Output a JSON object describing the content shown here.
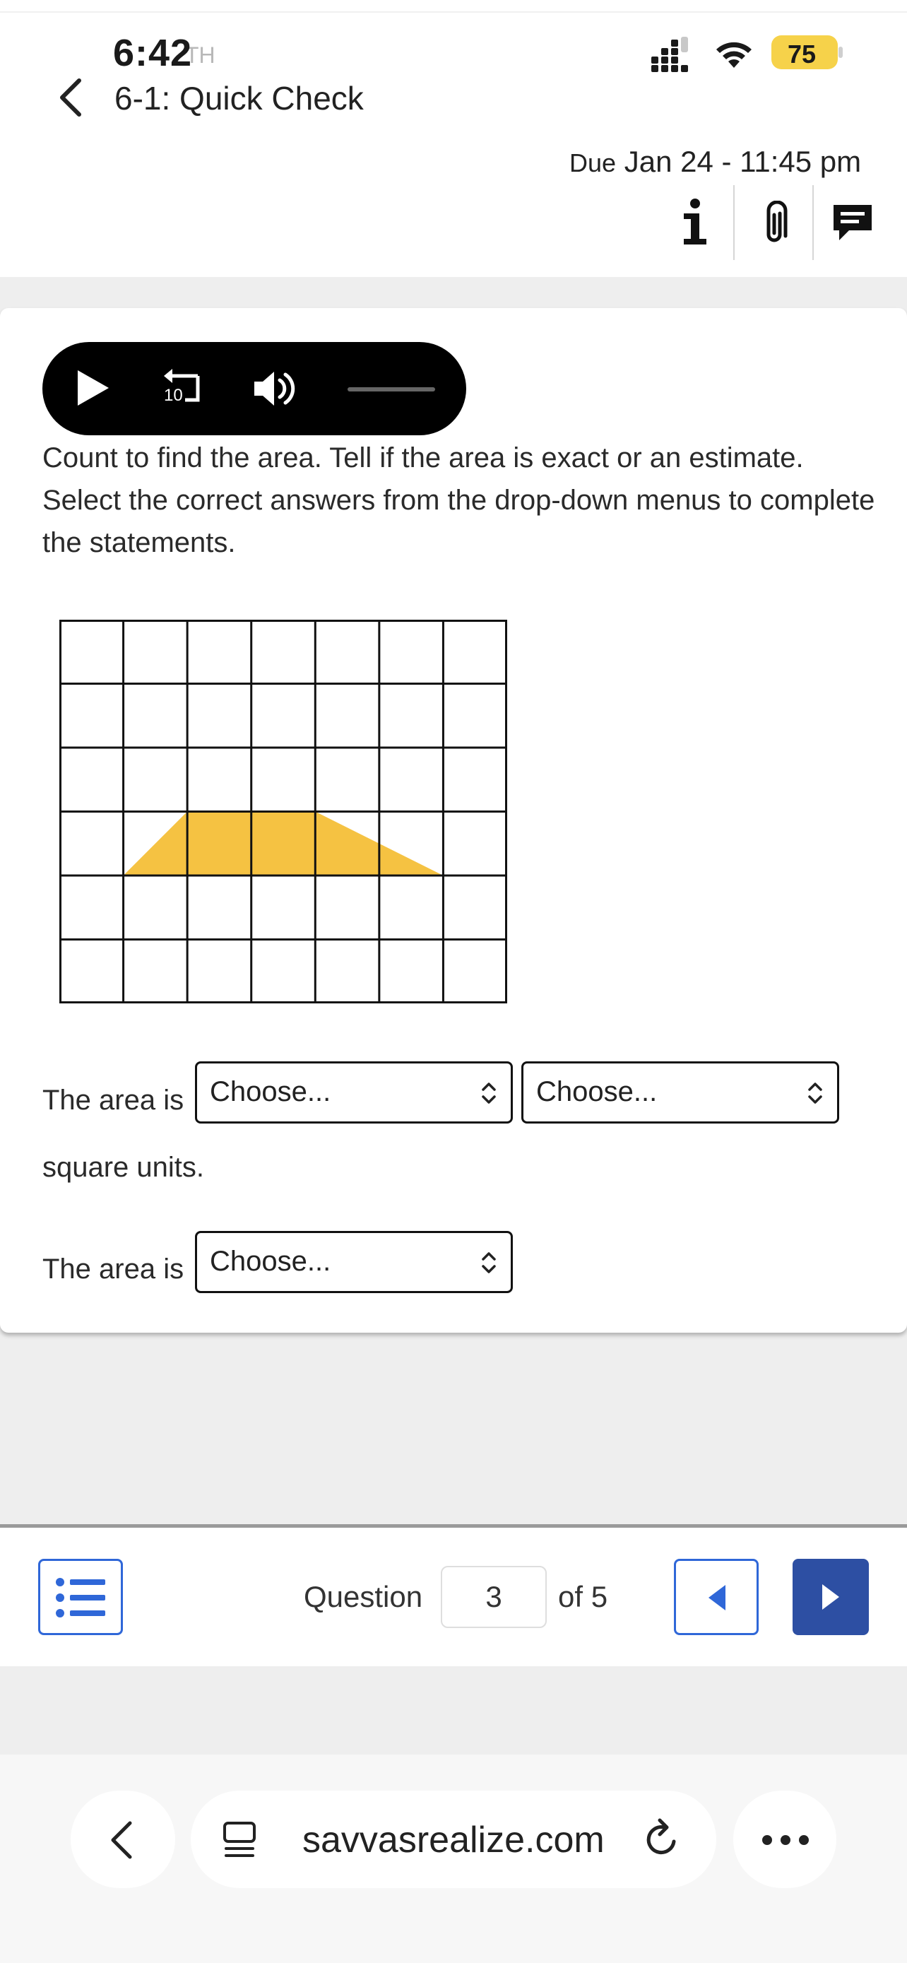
{
  "status_bar": {
    "time": "6:42",
    "time_overlay_text": "TH",
    "battery_percent": "75",
    "icons": [
      "cellular-signal-icon",
      "wifi-icon",
      "battery-icon"
    ]
  },
  "header": {
    "back_icon": "chevron-left-icon",
    "title": "6-1: Quick Check",
    "due_prefix": "Due",
    "due_value": "Jan 24 - 11:45 pm",
    "actions": [
      "info-icon",
      "paperclip-icon",
      "comment-icon"
    ]
  },
  "media_player": {
    "icons": [
      "play-icon",
      "replay-10-icon",
      "volume-icon"
    ],
    "replay_seconds": "10"
  },
  "question": {
    "instructions": "Count to find the area. Tell if the area is exact or an estimate. Select the correct answers from the drop-down menus to complete the statements.",
    "figure": {
      "columns": 7,
      "rows": 6,
      "shape": "trapezoid",
      "shape_vertices_in_grid_units": [
        [
          1,
          4
        ],
        [
          2,
          3
        ],
        [
          4,
          3
        ],
        [
          6,
          4
        ]
      ],
      "shape_color": "#f5c242",
      "grid_line_color": "#111111"
    },
    "statement1_prefix": "The area is",
    "statement1_suffix": "square units.",
    "statement2_prefix": "The area is",
    "select1_value": "Choose...",
    "select2_value": "Choose...",
    "select3_value": "Choose..."
  },
  "navigation": {
    "list_icon": "list-icon",
    "question_label": "Question",
    "question_current": "3",
    "question_total_text": "of 5",
    "prev_icon": "caret-left-icon",
    "next_icon": "caret-right-icon",
    "accent_color": "#2f67d8",
    "next_button_color": "#2d4fa3"
  },
  "browser": {
    "back_icon": "chevron-left-icon",
    "tabs_icon": "tabs-icon",
    "url": "savvasrealize.com",
    "reload_icon": "reload-icon",
    "more_icon": "more-dots-icon"
  }
}
